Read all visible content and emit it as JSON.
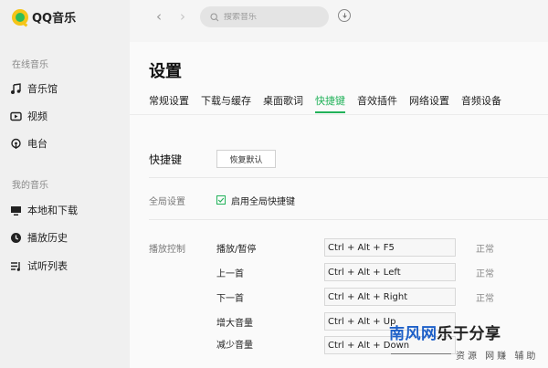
{
  "app": {
    "name": "QQ音乐"
  },
  "sidebar": {
    "online_section": "在线音乐",
    "online_items": [
      {
        "label": "音乐馆",
        "icon": "music-note-icon"
      },
      {
        "label": "视频",
        "icon": "video-icon"
      },
      {
        "label": "电台",
        "icon": "radio-icon"
      }
    ],
    "mine_section": "我的音乐",
    "mine_items": [
      {
        "label": "本地和下载",
        "icon": "monitor-icon"
      },
      {
        "label": "播放历史",
        "icon": "clock-icon"
      },
      {
        "label": "试听列表",
        "icon": "playlist-icon"
      }
    ]
  },
  "topbar": {
    "back": "‹",
    "forward": "›",
    "search_placeholder": "搜索音乐"
  },
  "settings": {
    "title": "设置",
    "tabs": [
      "常规设置",
      "下载与缓存",
      "桌面歌词",
      "快捷键",
      "音效插件",
      "网络设置",
      "音频设备"
    ],
    "active_tab": "快捷键",
    "section_title": "快捷键",
    "restore_button": "恢复默认",
    "global_label": "全局设置",
    "global_checkbox": "启用全局快捷键",
    "global_checked": true,
    "playback_label": "播放控制",
    "shortcuts": [
      {
        "action": "播放/暂停",
        "keys": "Ctrl + Alt + F5",
        "status": "正常"
      },
      {
        "action": "上一首",
        "keys": "Ctrl + Alt + Left",
        "status": "正常"
      },
      {
        "action": "下一首",
        "keys": "Ctrl + Alt + Right",
        "status": "正常"
      },
      {
        "action": "增大音量",
        "keys": "Ctrl + Alt + Up",
        "status": ""
      },
      {
        "action": "减少音量",
        "keys": "Ctrl + Alt + Down",
        "status": ""
      }
    ]
  },
  "watermark": {
    "brand_blue": "南风网",
    "brand_dark": "乐于分享",
    "sub": "资源 网赚 辅助"
  },
  "colors": {
    "accent": "#22b25a",
    "watermark_blue": "#1e60c8"
  }
}
